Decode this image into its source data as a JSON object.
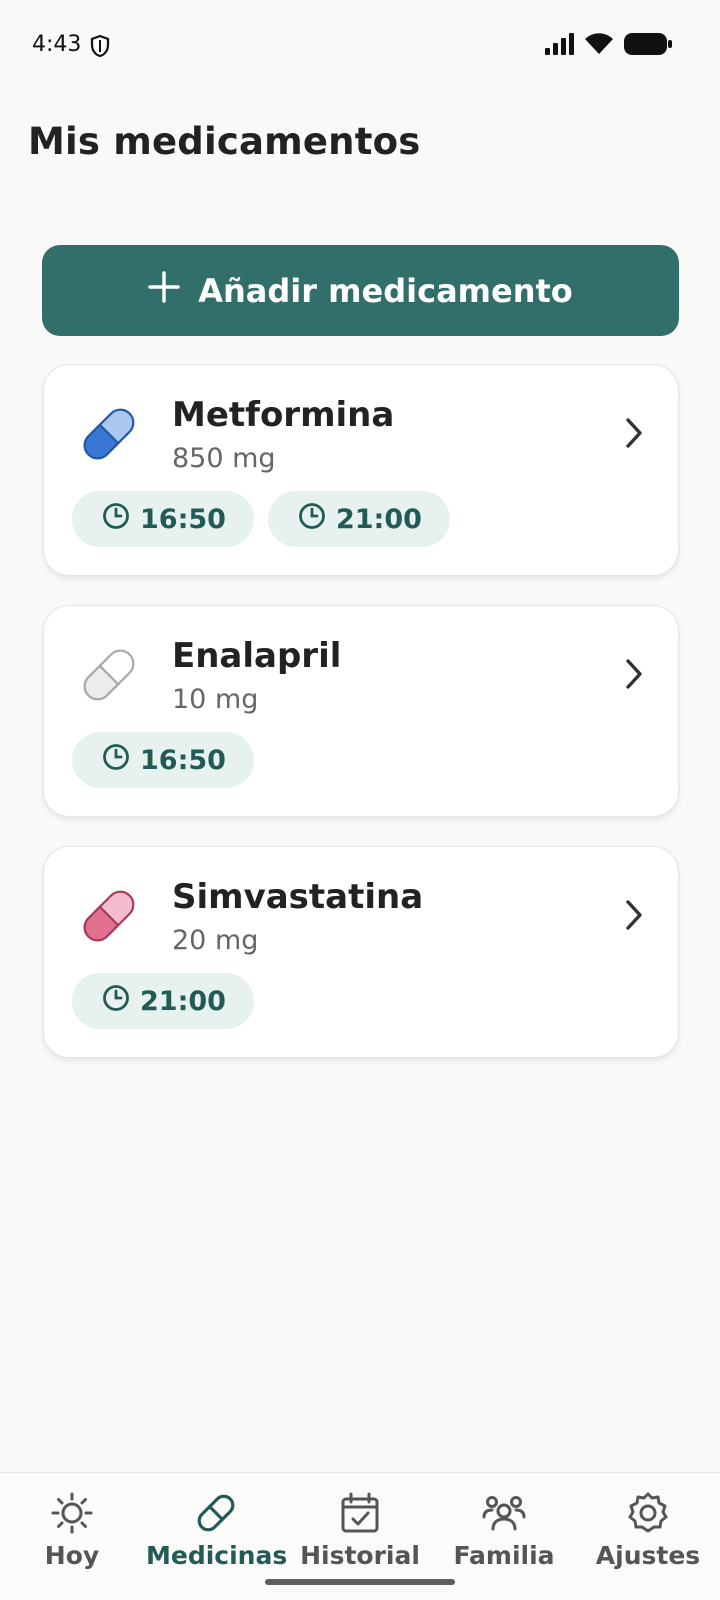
{
  "status_bar": {
    "time": "4:43"
  },
  "header": {
    "title": "Mis medicamentos"
  },
  "add_button": {
    "label": "Añadir medicamento"
  },
  "medications": [
    {
      "name": "Metformina",
      "dose": "850 mg",
      "times": [
        "16:50",
        "21:00"
      ],
      "pill_color": "#3a78d6"
    },
    {
      "name": "Enalapril",
      "dose": "10 mg",
      "times": [
        "16:50"
      ],
      "pill_color": "#e9e9e6"
    },
    {
      "name": "Simvastatina",
      "dose": "20 mg",
      "times": [
        "21:00"
      ],
      "pill_color": "#e0718f"
    }
  ],
  "nav": {
    "items": [
      {
        "label": "Hoy",
        "icon": "sun-icon"
      },
      {
        "label": "Medicinas",
        "icon": "pill-icon"
      },
      {
        "label": "Historial",
        "icon": "calendar-check-icon"
      },
      {
        "label": "Familia",
        "icon": "people-icon"
      },
      {
        "label": "Ajustes",
        "icon": "gear-icon"
      }
    ],
    "active": "Medicinas"
  },
  "colors": {
    "accent": "#326f6a",
    "chip_bg": "#e7f1ef",
    "chip_text": "#225a55"
  }
}
